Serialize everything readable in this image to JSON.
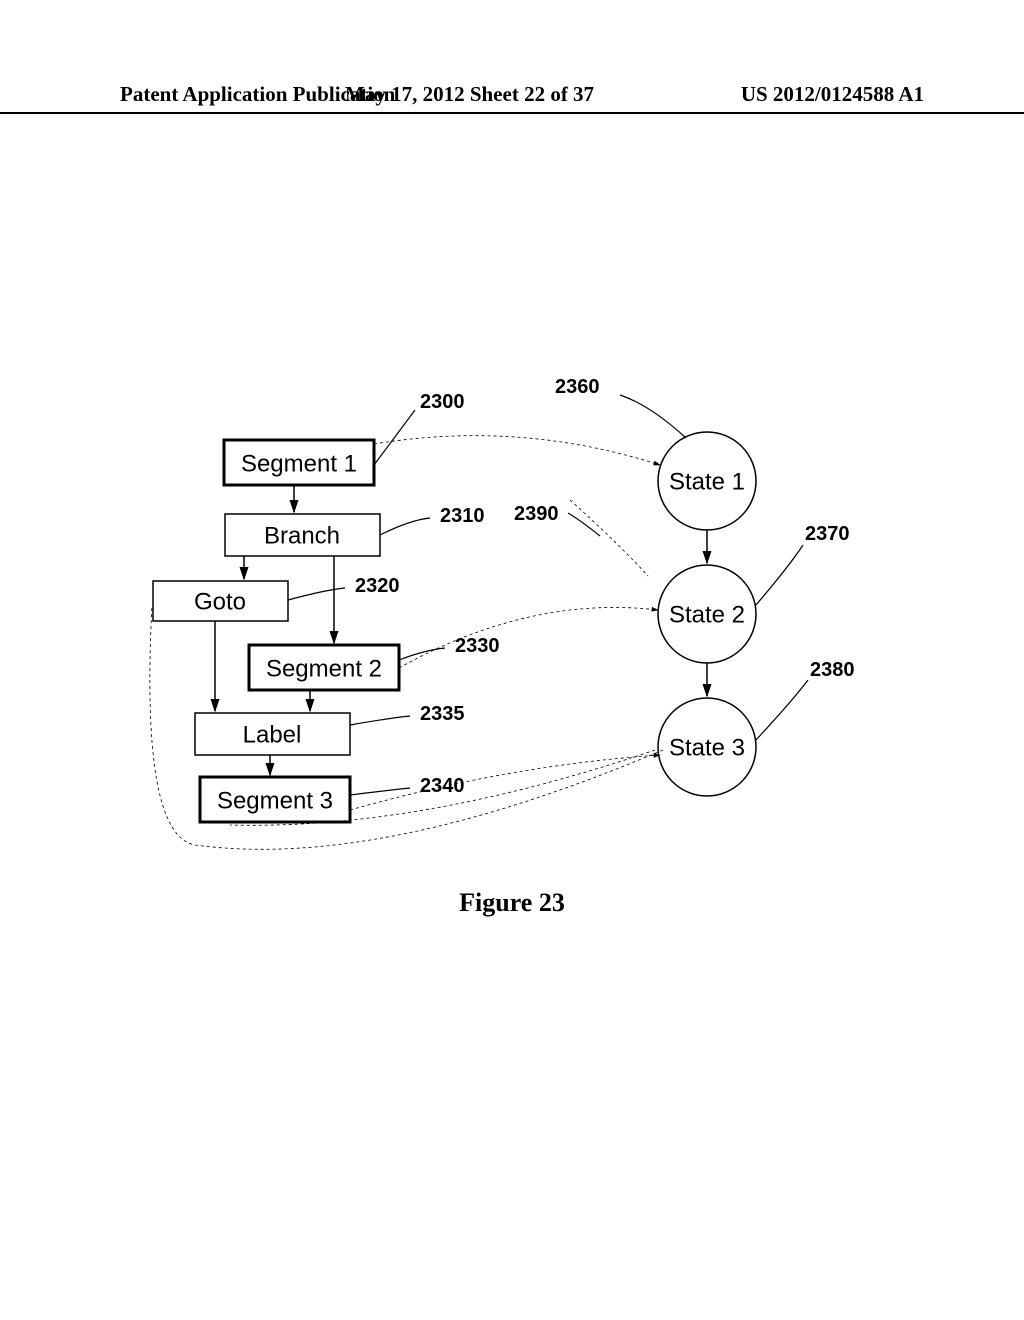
{
  "header": {
    "left": "Patent Application Publication",
    "mid": "May 17, 2012 Sheet 22 of 37",
    "right": "US 2012/0124588 A1"
  },
  "figure_caption": "Figure 23",
  "nodes": {
    "seg1": "Segment 1",
    "branch": "Branch",
    "goto": "Goto",
    "seg2": "Segment 2",
    "label": "Label",
    "seg3": "Segment 3",
    "state1": "State 1",
    "state2": "State 2",
    "state3": "State 3"
  },
  "refs": {
    "r2300": "2300",
    "r2310": "2310",
    "r2320": "2320",
    "r2330": "2330",
    "r2335": "2335",
    "r2340": "2340",
    "r2360": "2360",
    "r2370": "2370",
    "r2380": "2380",
    "r2390": "2390"
  }
}
